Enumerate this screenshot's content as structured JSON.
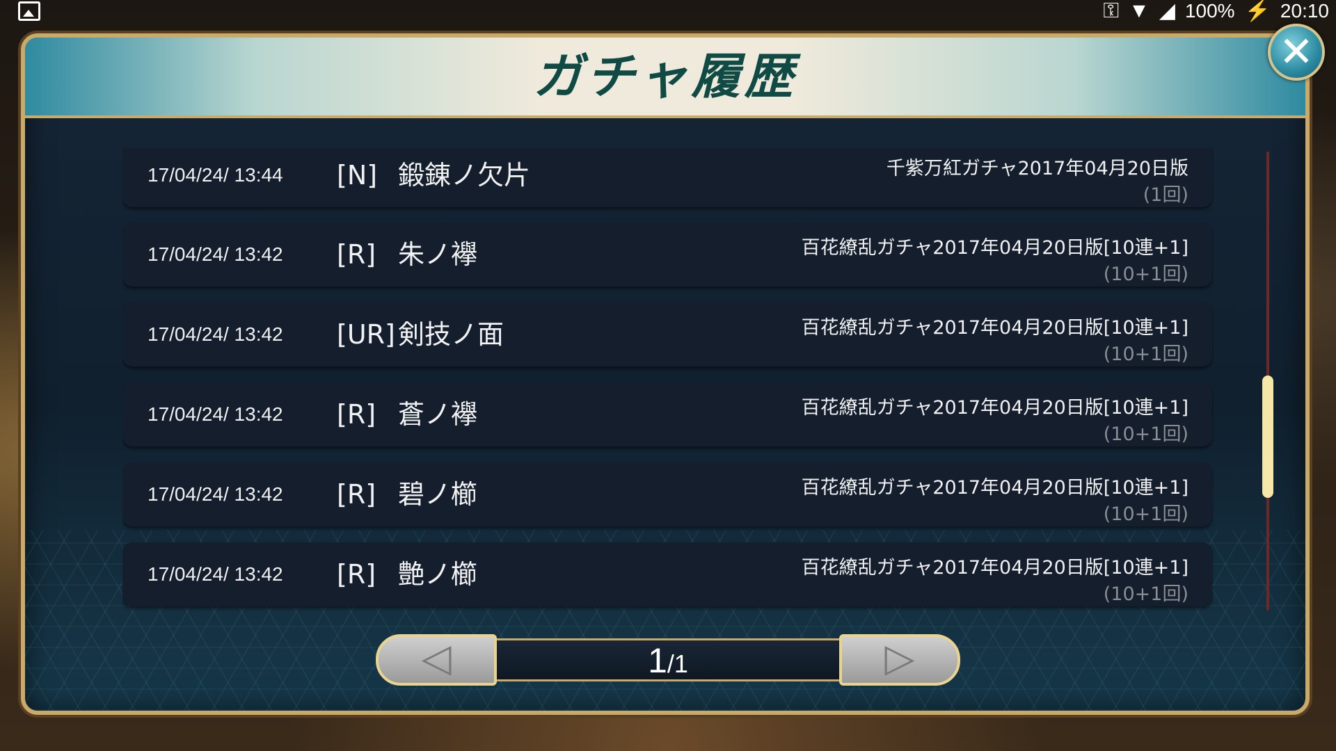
{
  "status_bar": {
    "battery": "100%",
    "time": "20:10"
  },
  "dialog": {
    "title": "ガチャ履歴"
  },
  "rows": [
    {
      "date": "17/04/24/ 13:44",
      "rarity": "[N]",
      "item": "鍛錬ノ欠片",
      "source": "千紫万紅ガチャ2017年04月20日版",
      "count": "(1回)"
    },
    {
      "date": "17/04/24/ 13:42",
      "rarity": "[R]",
      "item": "朱ノ襷",
      "source": "百花繚乱ガチャ2017年04月20日版[10連+1]",
      "count": "(10+1回)"
    },
    {
      "date": "17/04/24/ 13:42",
      "rarity": "[UR]",
      "item": "剣技ノ面",
      "source": "百花繚乱ガチャ2017年04月20日版[10連+1]",
      "count": "(10+1回)"
    },
    {
      "date": "17/04/24/ 13:42",
      "rarity": "[R]",
      "item": "蒼ノ襷",
      "source": "百花繚乱ガチャ2017年04月20日版[10連+1]",
      "count": "(10+1回)"
    },
    {
      "date": "17/04/24/ 13:42",
      "rarity": "[R]",
      "item": "碧ノ櫛",
      "source": "百花繚乱ガチャ2017年04月20日版[10連+1]",
      "count": "(10+1回)"
    },
    {
      "date": "17/04/24/ 13:42",
      "rarity": "[R]",
      "item": "艶ノ櫛",
      "source": "百花繚乱ガチャ2017年04月20日版[10連+1]",
      "count": "(10+1回)"
    }
  ],
  "pager": {
    "current": "1",
    "separator": "/",
    "total": "1",
    "prev_icon": "chevron-left-icon",
    "next_icon": "chevron-right-icon"
  },
  "scroll": {
    "position_fraction": 0.49
  },
  "colors": {
    "accent_gold": "#c8ab6a",
    "title_teal": "#0f4a45",
    "row_bg": "#141e2c"
  }
}
